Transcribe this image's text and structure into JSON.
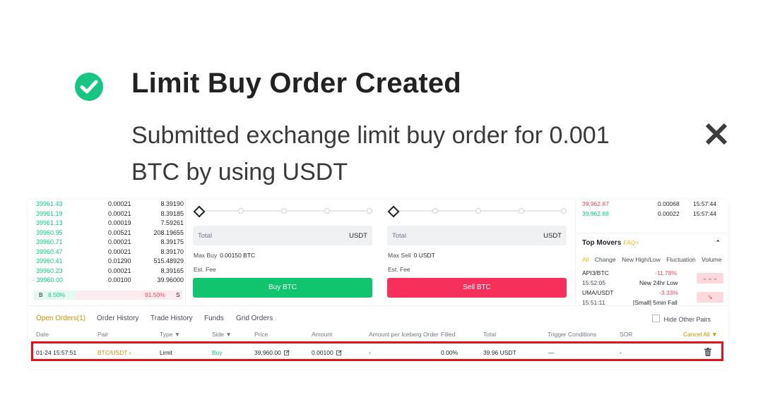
{
  "toast": {
    "title": "Limit Buy Order Created",
    "message": "Submitted exchange limit buy order for 0.001 BTC by using USDT",
    "success_color": "#16c784",
    "icons": {
      "status": "check-circle-icon",
      "close": "close-icon"
    }
  },
  "order_book": {
    "rows": [
      {
        "price": "39961.43",
        "amount": "0.00021",
        "total": "8.39190"
      },
      {
        "price": "39961.19",
        "amount": "0.00021",
        "total": "8.39185"
      },
      {
        "price": "39961.13",
        "amount": "0.00019",
        "total": "7.59261"
      },
      {
        "price": "39960.95",
        "amount": "0.00521",
        "total": "208.19655"
      },
      {
        "price": "39960.71",
        "amount": "0.00021",
        "total": "8.39175"
      },
      {
        "price": "39960.47",
        "amount": "0.00021",
        "total": "8.39170"
      },
      {
        "price": "39960.41",
        "amount": "0.01290",
        "total": "515.48929"
      },
      {
        "price": "39960.23",
        "amount": "0.00021",
        "total": "8.39165"
      },
      {
        "price": "39960.00",
        "amount": "0.00100",
        "total": "39.96000"
      }
    ],
    "ratio": {
      "buy_label": "B",
      "buy_pct": "8.50%",
      "sell_pct": "91.50%",
      "sell_label": "S"
    }
  },
  "buy_form": {
    "total_label": "Total",
    "unit": "USDT",
    "max_label": "Max Buy",
    "max_value": "0.00150 BTC",
    "fee_label": "Est. Fee",
    "button": "Buy BTC"
  },
  "sell_form": {
    "total_label": "Total",
    "unit": "USDT",
    "max_label": "Max Sell",
    "max_value": "0 USDT",
    "fee_label": "Est. Fee",
    "button": "Sell BTC"
  },
  "trades": [
    {
      "price": "39,962.87",
      "amount": "0.00068",
      "time": "15:57:44",
      "color": "#f6465d"
    },
    {
      "price": "39,962.88",
      "amount": "0.00022",
      "time": "15:57:44",
      "color": "#0ecb81"
    }
  ],
  "top_movers": {
    "title": "Top Movers",
    "faq": "FAQ>",
    "tabs": [
      "All",
      "Change",
      "New High/Low",
      "Fluctuation",
      "Volume"
    ],
    "items": [
      {
        "pair": "API3/BTC",
        "change": "-11.78%",
        "time": "15:52:05",
        "desc": "New 24hr Low"
      },
      {
        "pair": "UMA/USDT",
        "change": "-3.33%",
        "time": "15:51:11",
        "desc": "[Small] 5min Fall"
      }
    ]
  },
  "orders": {
    "tabs": [
      "Open Orders(1)",
      "Order History",
      "Trade History",
      "Funds",
      "Grid Orders"
    ],
    "hide_other_pairs": "Hide Other Pairs",
    "columns": {
      "date": "Date",
      "pair": "Pair",
      "type": "Type ▼",
      "side": "Side ▼",
      "price": "Price",
      "amount": "Amount",
      "iceberg": "Amount per Iceberg Order",
      "filled": "Filled",
      "total": "Total",
      "trigger": "Trigger Conditions",
      "sor": "SOR",
      "cancel_all": "Cancel All ▼"
    },
    "row": {
      "date": "01-24 15:57:51",
      "pair": "BTC/USDT ›",
      "type": "Limit",
      "side": "Buy",
      "price": "39,960.00",
      "amount": "0.00100",
      "iceberg": "-",
      "filled": "0.00%",
      "total": "39.96 USDT",
      "trigger": "—",
      "sor": "-"
    },
    "highlight_color": "#e0121a"
  }
}
